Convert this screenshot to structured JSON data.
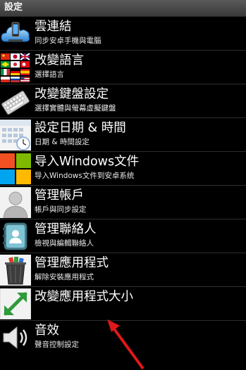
{
  "header": {
    "title": "設定"
  },
  "items": [
    {
      "icon": "cloud-phone-icon",
      "title": "雲連結",
      "subtitle": "同步安卓手機與電腦"
    },
    {
      "icon": "language-flags-icon",
      "title": "改變語言",
      "subtitle": "選擇語言"
    },
    {
      "icon": "keyboard-icon",
      "title": "改變鍵盤設定",
      "subtitle": "選擇實體與螢幕虛擬鍵盤"
    },
    {
      "icon": "calendar-icon",
      "title": "設定日期 & 時間",
      "subtitle": "日期 & 時間設定"
    },
    {
      "icon": "windows-logo-icon",
      "title": "导入Windows文件",
      "subtitle": "导入Windows文件到安卓系统"
    },
    {
      "icon": "user-account-icon",
      "title": "管理帳戶",
      "subtitle": "帳戶與同步設定"
    },
    {
      "icon": "contacts-book-icon",
      "title": "管理聯絡人",
      "subtitle": "檢視與編輯聯絡人"
    },
    {
      "icon": "recycle-bin-icon",
      "title": "管理應用程式",
      "subtitle": "解除安裝應用程式"
    },
    {
      "icon": "resize-arrows-icon",
      "title": "改變應用程式大小",
      "subtitle": ""
    },
    {
      "icon": "speaker-icon",
      "title": "音效",
      "subtitle": "聲音控制設定"
    }
  ],
  "colors": {
    "arrow": "#e01818",
    "windows_red": "#f25022",
    "windows_green": "#7fba00",
    "windows_blue": "#00a4ef",
    "windows_yellow": "#ffb900",
    "resize_green": "#2e9a3a"
  }
}
